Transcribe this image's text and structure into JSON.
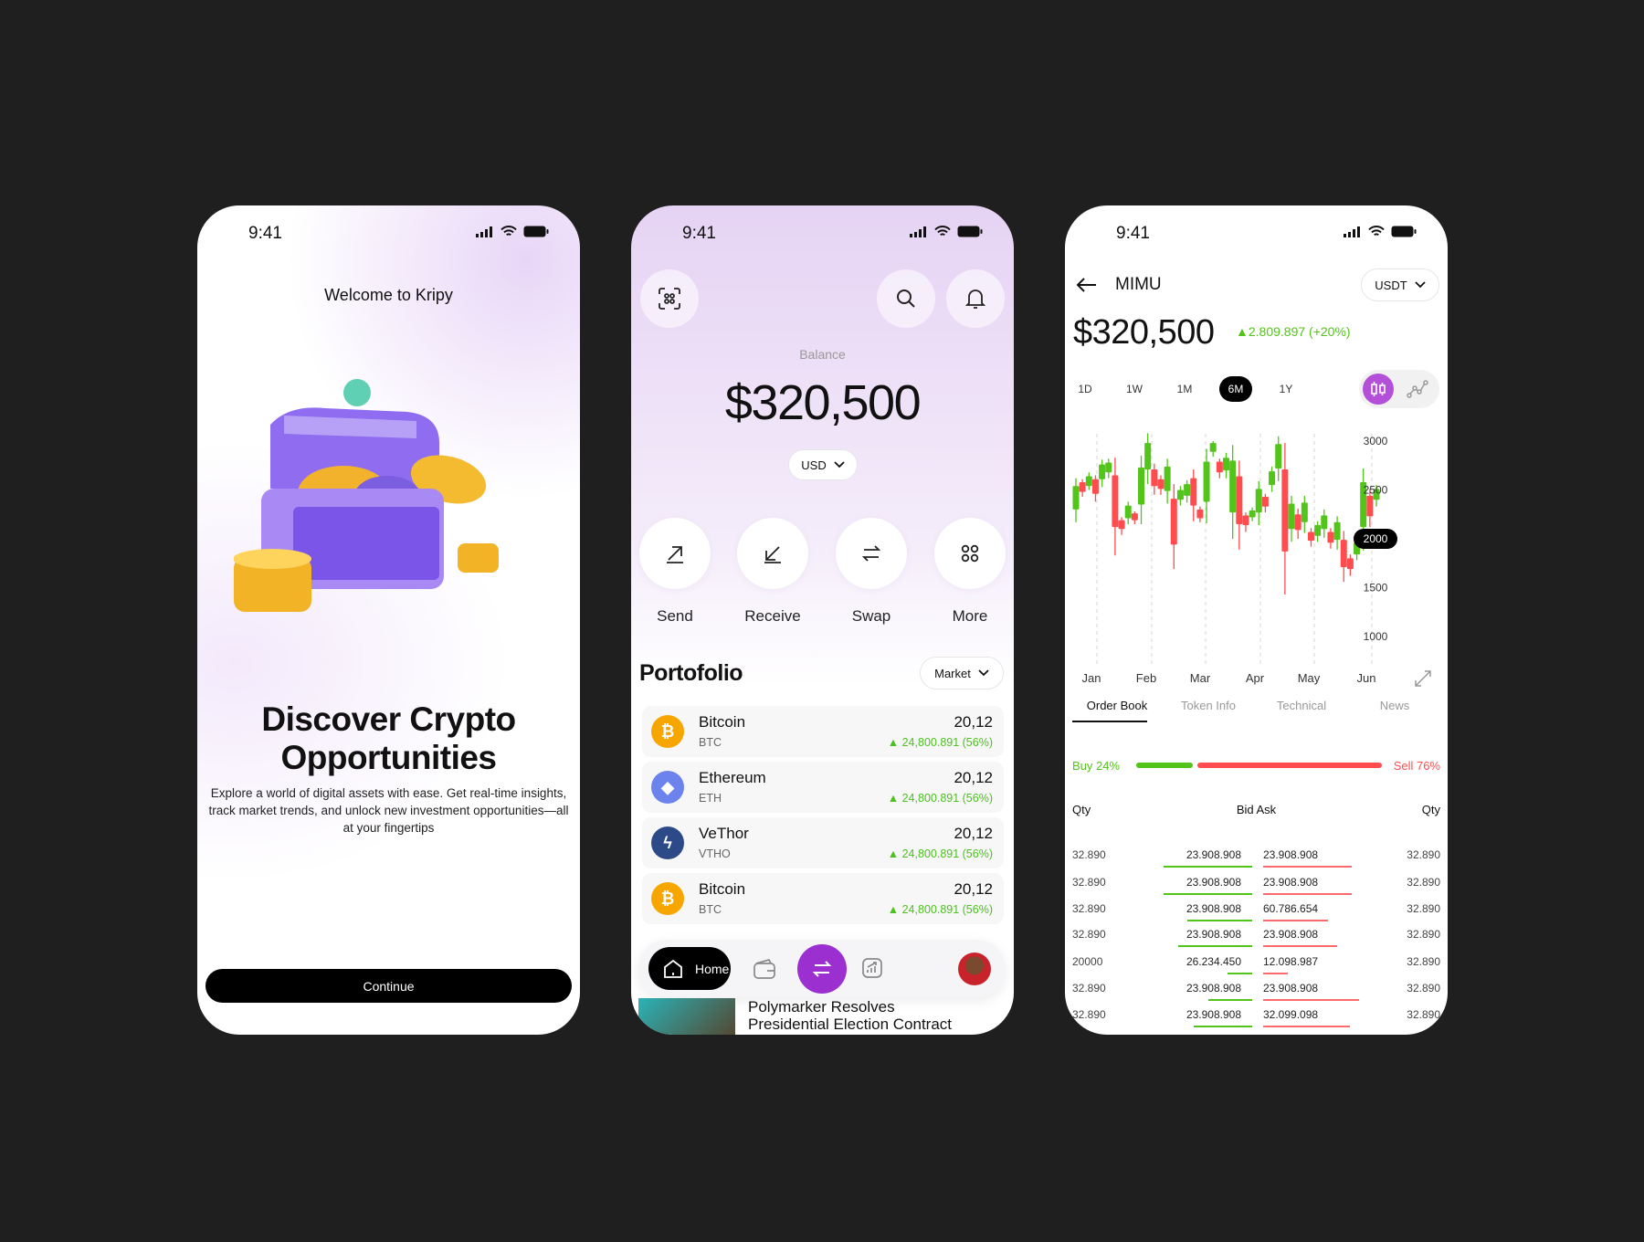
{
  "status_bar": {
    "time": "9:41"
  },
  "onboarding": {
    "title": "Welcome to Kripy",
    "headline_line1": "Discover Crypto",
    "headline_line2": "Opportunities",
    "body": "Explore a world of digital assets with ease. Get real-time insights, track market trends, and unlock new investment opportunities—all at your fingertips",
    "continue_label": "Continue"
  },
  "home": {
    "balance_label": "Balance",
    "balance": "$320,500",
    "currency": "USD",
    "actions": [
      {
        "label": "Send",
        "icon": "arrow-up-right-icon"
      },
      {
        "label": "Receive",
        "icon": "arrow-down-left-icon"
      },
      {
        "label": "Swap",
        "icon": "swap-icon"
      },
      {
        "label": "More",
        "icon": "grid-icon"
      }
    ],
    "portfolio_title": "Portofolio",
    "portfolio_filter": "Market",
    "portfolio": [
      {
        "name": "Bitcoin",
        "symbol": "BTC",
        "amount": "20,12",
        "change": "24,800.891 (56%)",
        "color": "#F7A600",
        "glyph": "₿"
      },
      {
        "name": "Ethereum",
        "symbol": "ETH",
        "amount": "20,12",
        "change": "24,800.891 (56%)",
        "color": "#6C83EE",
        "glyph": "◆"
      },
      {
        "name": "VeThor",
        "symbol": "VTHO",
        "amount": "20,12",
        "change": "24,800.891 (56%)",
        "color": "#2C4A88",
        "glyph": "ϟ"
      },
      {
        "name": "Bitcoin",
        "symbol": "BTC",
        "amount": "20,12",
        "change": "24,800.891 (56%)",
        "color": "#F7A600",
        "glyph": "₿"
      }
    ],
    "nav": {
      "home_label": "Home"
    },
    "news_title_line1": "Polymarker Resolves",
    "news_title_line2": "Presidential Election Contract"
  },
  "detail": {
    "title": "MIMU",
    "quote_currency": "USDT",
    "price": "$320,500",
    "change": "▲2.809.897 (+20%)",
    "ranges": [
      "1D",
      "1W",
      "1M",
      "6M",
      "1Y"
    ],
    "active_range": "6M",
    "tabs": [
      "Order Book",
      "Token Info",
      "Technical",
      "News"
    ],
    "buy_label": "Buy 24%",
    "sell_label": "Sell 76%",
    "buy_percent": 24,
    "sell_percent": 76,
    "headers": {
      "qty_left": "Qty",
      "bid_ask": "Bid Ask",
      "qty_right": "Qty"
    },
    "order_book": [
      {
        "bid_qty": "32.890",
        "bid": "23.908.908",
        "ask": "23.908.908",
        "ask_qty": "32.890",
        "bid_depth": 0.9,
        "ask_depth": 0.9
      },
      {
        "bid_qty": "32.890",
        "bid": "23.908.908",
        "ask": "23.908.908",
        "ask_qty": "32.890",
        "bid_depth": 0.9,
        "ask_depth": 0.9
      },
      {
        "bid_qty": "32.890",
        "bid": "23.908.908",
        "ask": "60.786.654",
        "ask_qty": "32.890",
        "bid_depth": 0.66,
        "ask_depth": 0.66
      },
      {
        "bid_qty": "32.890",
        "bid": "23.908.908",
        "ask": "23.908.908",
        "ask_qty": "32.890",
        "bid_depth": 0.75,
        "ask_depth": 0.75
      },
      {
        "bid_qty": "20000",
        "bid": "26.234.450",
        "ask": "12.098.987",
        "ask_qty": "32.890",
        "bid_depth": 0.25,
        "ask_depth": 0.25
      },
      {
        "bid_qty": "32.890",
        "bid": "23.908.908",
        "ask": "23.908.908",
        "ask_qty": "32.890",
        "bid_depth": 0.44,
        "ask_depth": 0.97
      },
      {
        "bid_qty": "32.890",
        "bid": "23.908.908",
        "ask": "32.099.098",
        "ask_qty": "32.890",
        "bid_depth": 0.59,
        "ask_depth": 0.88
      }
    ]
  },
  "colors": {
    "accent": "#9B2FD0",
    "up": "#52C41A",
    "down": "#FF4D4F"
  },
  "chart_data": {
    "type": "candlestick",
    "categories": [
      "Jan",
      "Feb",
      "Mar",
      "Apr",
      "May",
      "Jun"
    ],
    "yticks": [
      "3000",
      "2500",
      "2000",
      "1500",
      "1000"
    ],
    "highlighted_tick": "2000",
    "ylim": [
      1000,
      3000
    ],
    "grid": "vertical dashed",
    "series": [
      {
        "ohlc": [
          [
            2300,
            2620,
            2170,
            2540
          ],
          [
            2580,
            2610,
            2430,
            2480
          ],
          [
            2540,
            2680,
            2500,
            2640
          ],
          [
            2610,
            2650,
            2380,
            2460
          ],
          [
            2610,
            2810,
            2530,
            2760
          ],
          [
            2680,
            2820,
            2620,
            2780
          ],
          [
            2650,
            2830,
            1830,
            2120
          ],
          [
            2190,
            2220,
            2040,
            2100
          ],
          [
            2210,
            2380,
            2150,
            2340
          ],
          [
            2260,
            2280,
            2150,
            2190
          ],
          [
            2350,
            2850,
            2150,
            2730
          ],
          [
            2710,
            3080,
            2560,
            2980
          ],
          [
            2710,
            2770,
            2450,
            2540
          ],
          [
            2610,
            2650,
            2450,
            2510
          ],
          [
            2490,
            2820,
            2360,
            2740
          ],
          [
            2410,
            2560,
            1690,
            1940
          ],
          [
            2400,
            2540,
            2340,
            2500
          ],
          [
            2440,
            2600,
            2370,
            2560
          ],
          [
            2620,
            2710,
            2180,
            2340
          ],
          [
            2300,
            2330,
            2170,
            2210
          ],
          [
            2380,
            2920,
            2160,
            2790
          ],
          [
            2890,
            3000,
            2840,
            2980
          ],
          [
            2790,
            2820,
            2620,
            2680
          ],
          [
            2700,
            2880,
            2620,
            2830
          ],
          [
            2270,
            2960,
            2000,
            2800
          ],
          [
            2640,
            2800,
            1890,
            2150
          ],
          [
            2240,
            2270,
            2070,
            2140
          ],
          [
            2220,
            2320,
            2180,
            2290
          ],
          [
            2270,
            2590,
            2140,
            2510
          ],
          [
            2430,
            2460,
            2270,
            2330
          ],
          [
            2550,
            2740,
            2480,
            2690
          ],
          [
            2720,
            3050,
            2590,
            2970
          ],
          [
            2710,
            2980,
            1430,
            1870
          ],
          [
            2100,
            2440,
            1970,
            2360
          ],
          [
            2250,
            2310,
            2000,
            2090
          ],
          [
            2170,
            2440,
            2060,
            2370
          ],
          [
            2070,
            2110,
            1920,
            1980
          ],
          [
            2030,
            2180,
            1970,
            2140
          ],
          [
            2100,
            2300,
            2010,
            2240
          ],
          [
            2070,
            2110,
            1900,
            1960
          ],
          [
            1990,
            2230,
            1890,
            2170
          ],
          [
            1990,
            2080,
            1560,
            1710
          ],
          [
            1800,
            1840,
            1620,
            1690
          ],
          [
            1840,
            2000,
            1780,
            1960
          ],
          [
            2120,
            2720,
            1880,
            2580
          ],
          [
            2440,
            2510,
            2120,
            2230
          ],
          [
            2400,
            2550,
            2330,
            2510
          ]
        ]
      }
    ]
  }
}
